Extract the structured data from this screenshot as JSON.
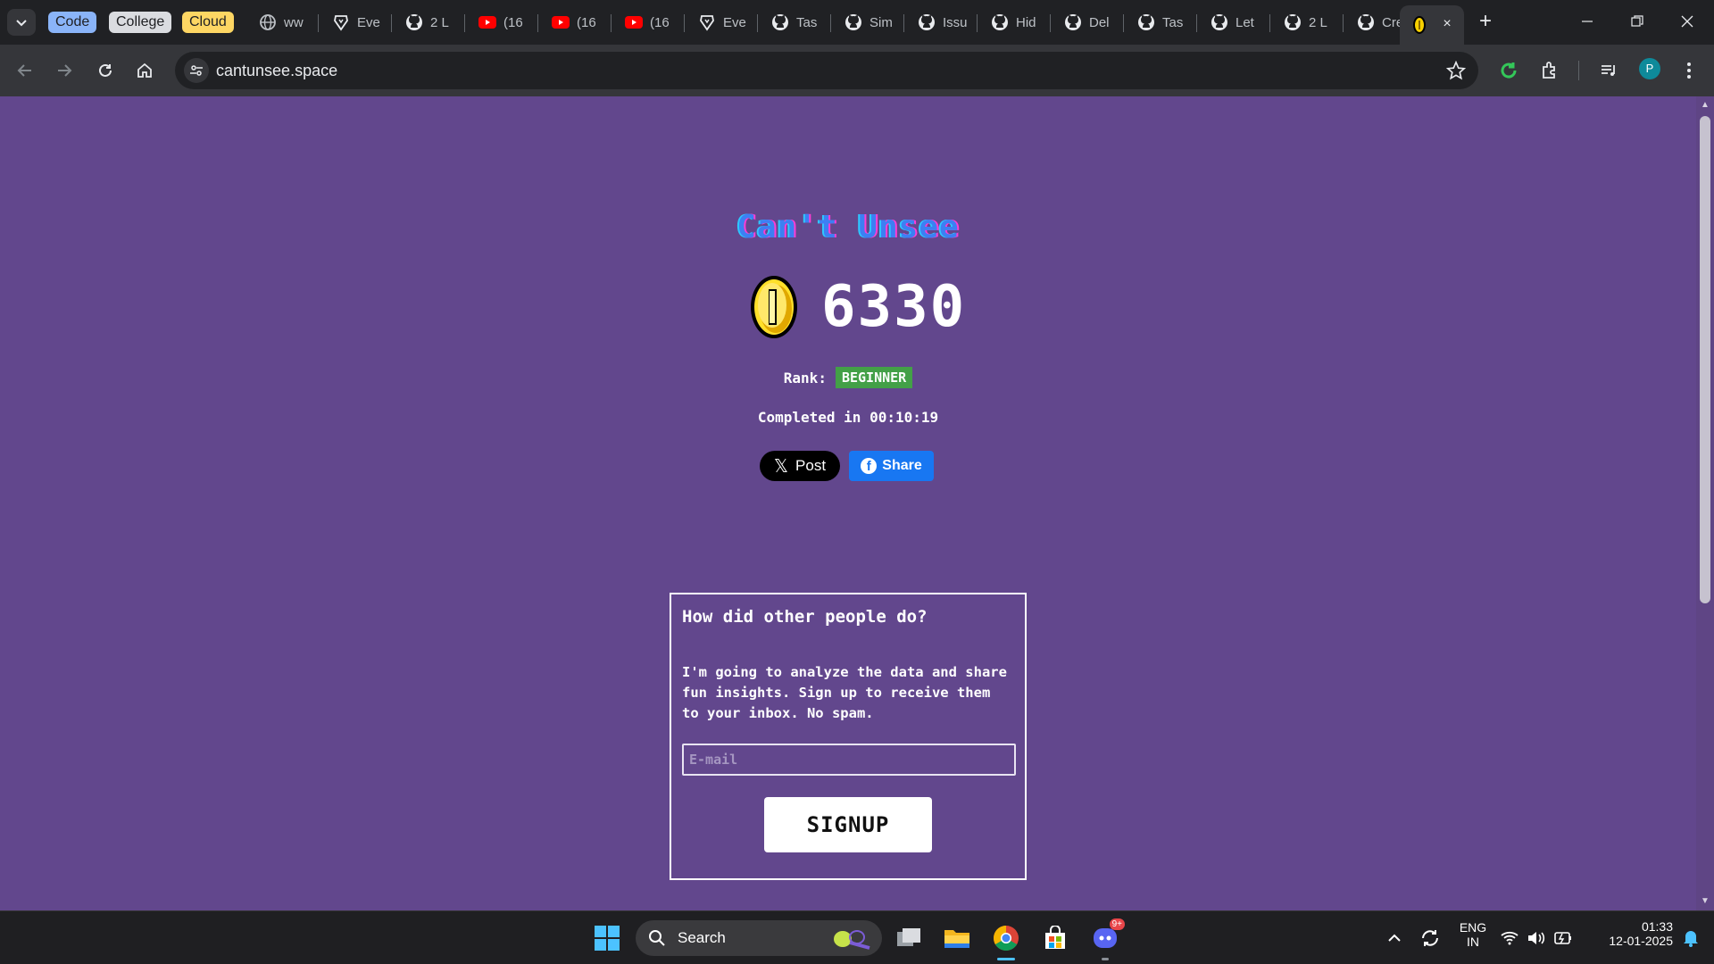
{
  "browser": {
    "tab_groups": [
      {
        "label": "Code",
        "color": "#8ab4f8"
      },
      {
        "label": "College",
        "color": "#dadce0"
      },
      {
        "label": "Cloud",
        "color": "#fdd663"
      }
    ],
    "tabs": [
      {
        "title": "ww",
        "icon": "globe-icon"
      },
      {
        "title": "Eve",
        "icon": "brave-shield-icon"
      },
      {
        "title": "2 L",
        "icon": "github-icon"
      },
      {
        "title": "(16",
        "icon": "youtube-icon"
      },
      {
        "title": "(16",
        "icon": "youtube-icon"
      },
      {
        "title": "(16",
        "icon": "youtube-icon"
      },
      {
        "title": "Eve",
        "icon": "brave-shield-icon"
      },
      {
        "title": "Tas",
        "icon": "github-icon"
      },
      {
        "title": "Sim",
        "icon": "github-icon"
      },
      {
        "title": "Issu",
        "icon": "github-icon"
      },
      {
        "title": "Hid",
        "icon": "github-icon"
      },
      {
        "title": "Del",
        "icon": "github-icon"
      },
      {
        "title": "Tas",
        "icon": "github-icon"
      },
      {
        "title": "Let",
        "icon": "github-icon"
      },
      {
        "title": "2 L",
        "icon": "github-icon"
      },
      {
        "title": "Cre",
        "icon": "github-icon"
      }
    ],
    "active_tab": {
      "icon": "coin-icon",
      "close": "×"
    },
    "new_tab": "+",
    "url": "cantunsee.space",
    "profile_initial": "P"
  },
  "page": {
    "title": "Can't Unsee",
    "score": "6330",
    "rank_label": "Rank:",
    "rank": "BEGINNER",
    "completed": "Completed in 00:10:19",
    "x_post": "Post",
    "fb_share": "Share",
    "card": {
      "heading": "How did other people do?",
      "text": "I'm going to analyze the data and share fun insights. Sign up to receive them to your inbox. No spam.",
      "email_placeholder": "E-mail",
      "signup": "SIGNUP"
    },
    "colors": {
      "background": "#62478d",
      "rank_badge": "#43a047",
      "facebook": "#1877f2"
    }
  },
  "taskbar": {
    "search": "Search",
    "lang": "ENG",
    "region": "IN",
    "time": "01:33",
    "date": "12-01-2025",
    "discord_badge": "9+"
  }
}
